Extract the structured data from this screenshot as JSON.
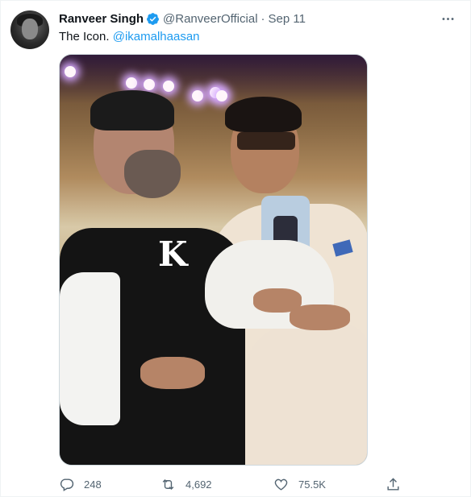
{
  "tweet": {
    "author_name": "Ranveer Singh",
    "verified_icon": "verified-badge-icon",
    "handle": "@RanveerOfficial",
    "separator": "·",
    "date": "Sep 11",
    "more_icon": "more-dots-icon",
    "text_main": "The Icon.",
    "text_mention": "@ikamalhaasan",
    "photo_letters": "K"
  },
  "actions": {
    "reply_count": "248",
    "retweet_count": "4,692",
    "like_count": "75.5K",
    "reply_icon": "reply-icon",
    "retweet_icon": "retweet-icon",
    "like_icon": "heart-icon",
    "share_icon": "share-icon"
  },
  "colors": {
    "accent": "#1d9bf0",
    "muted": "#536471",
    "text": "#0f1419"
  }
}
